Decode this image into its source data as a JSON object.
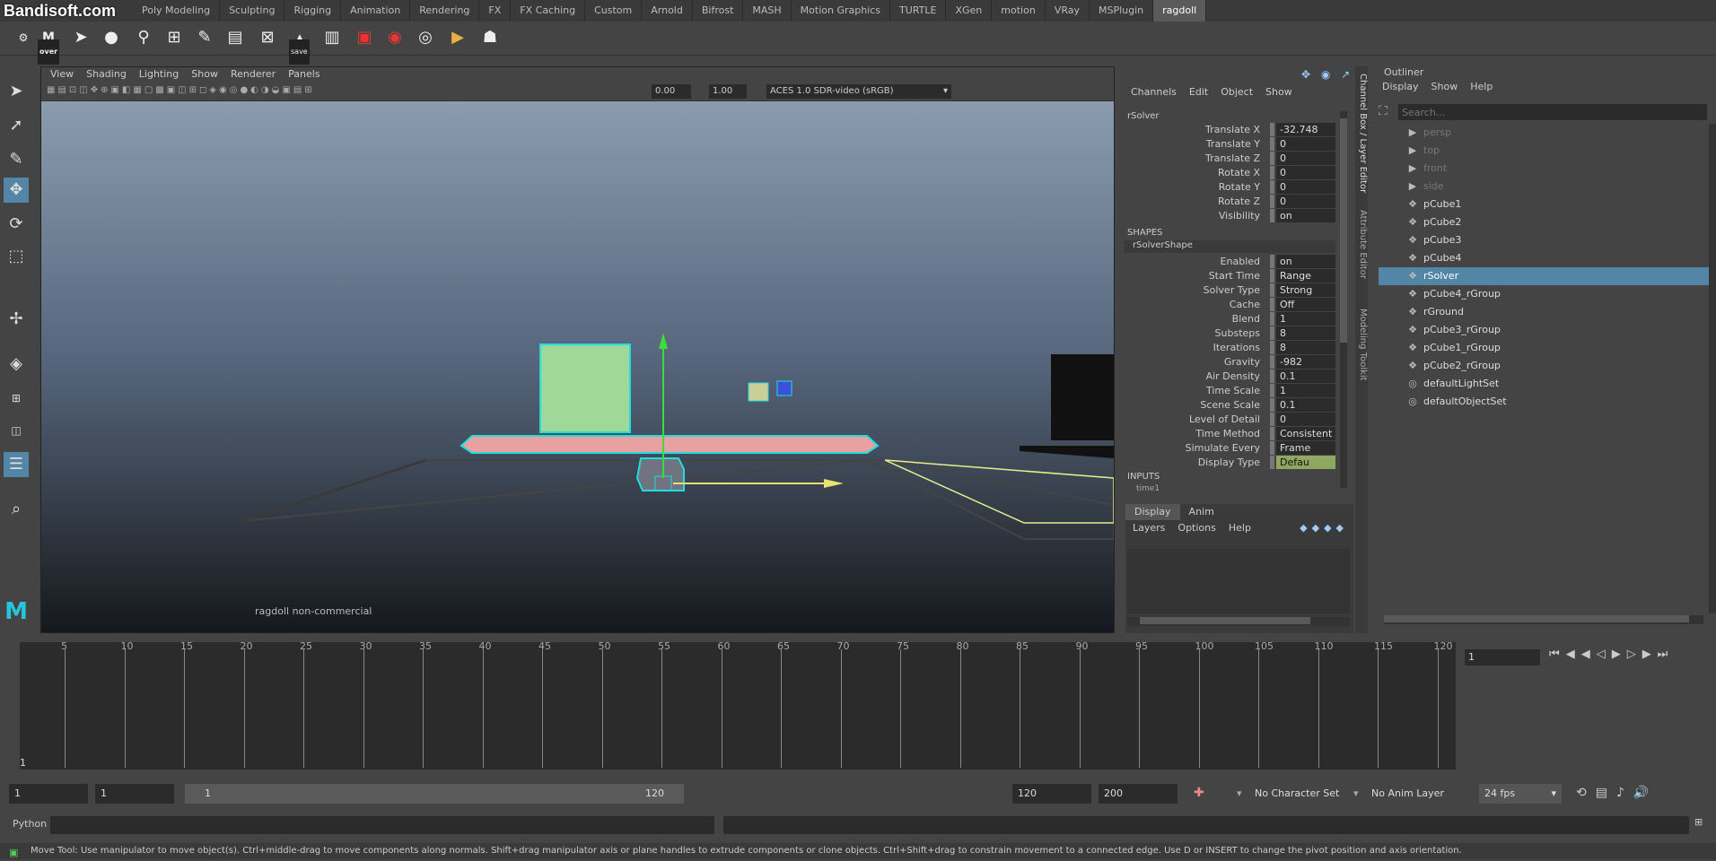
{
  "watermark": "Bandisoft.com",
  "shelf_tabs": [
    "Poly Modeling",
    "Sculpting",
    "Rigging",
    "Animation",
    "Rendering",
    "FX",
    "FX Caching",
    "Custom",
    "Arnold",
    "Bifrost",
    "MASH",
    "Motion Graphics",
    "TURTLE",
    "XGen",
    "motion",
    "VRay",
    "MSPlugin",
    "ragdoll"
  ],
  "active_tab": "ragdoll",
  "shelf": {
    "over_label": "over",
    "save_label": "save"
  },
  "viewport": {
    "menu": [
      "View",
      "Shading",
      "Lighting",
      "Show",
      "Renderer",
      "Panels"
    ],
    "exposure": "0.00",
    "gamma": "1.00",
    "colorspace": "ACES 1.0 SDR-video (sRGB)",
    "hud_text": "ragdoll non-commercial"
  },
  "channel_box": {
    "menu": [
      "Channels",
      "Edit",
      "Object",
      "Show"
    ],
    "node": "rSolver",
    "attrs": [
      {
        "label": "Translate X",
        "value": "-32.748"
      },
      {
        "label": "Translate Y",
        "value": "0"
      },
      {
        "label": "Translate Z",
        "value": "0"
      },
      {
        "label": "Rotate X",
        "value": "0"
      },
      {
        "label": "Rotate Y",
        "value": "0"
      },
      {
        "label": "Rotate Z",
        "value": "0"
      },
      {
        "label": "Visibility",
        "value": "on"
      }
    ],
    "shapes_header": "SHAPES",
    "shape_node": "rSolverShape",
    "shape_attrs": [
      {
        "label": "Enabled",
        "value": "on"
      },
      {
        "label": "Start Time",
        "value": "Range Start"
      },
      {
        "label": "Solver Type",
        "value": "Strong"
      },
      {
        "label": "Cache",
        "value": "Off"
      },
      {
        "label": "Blend",
        "value": "1"
      },
      {
        "label": "Substeps",
        "value": "8"
      },
      {
        "label": "Iterations",
        "value": "8"
      },
      {
        "label": "Gravity",
        "value": "-982"
      },
      {
        "label": "Air Density",
        "value": "0.1"
      },
      {
        "label": "Time Scale",
        "value": "1"
      },
      {
        "label": "Scene Scale",
        "value": "0.1"
      },
      {
        "label": "Level of Detail",
        "value": "0"
      },
      {
        "label": "Time Method",
        "value": "Consistent"
      },
      {
        "label": "Simulate Every",
        "value": "Frame"
      },
      {
        "label": "Display Type",
        "value": "Defau"
      }
    ],
    "inputs_header": "INPUTS",
    "input_node": "time1",
    "layer_tabs": [
      "Display",
      "Anim"
    ],
    "layer_menu": [
      "Layers",
      "Options",
      "Help"
    ]
  },
  "side_tabs": [
    "Channel Box / Layer Editor",
    "Attribute Editor",
    "Modeling Toolkit"
  ],
  "outliner": {
    "title": "Outliner",
    "menu": [
      "Display",
      "Show",
      "Help"
    ],
    "search_placeholder": "Search...",
    "items": [
      {
        "name": "persp",
        "dim": true
      },
      {
        "name": "top",
        "dim": true
      },
      {
        "name": "front",
        "dim": true
      },
      {
        "name": "side",
        "dim": true
      },
      {
        "name": "pCube1"
      },
      {
        "name": "pCube2"
      },
      {
        "name": "pCube3"
      },
      {
        "name": "pCube4"
      },
      {
        "name": "rSolver",
        "selected": true
      },
      {
        "name": "pCube4_rGroup"
      },
      {
        "name": "rGround"
      },
      {
        "name": "pCube3_rGroup"
      },
      {
        "name": "pCube1_rGroup"
      },
      {
        "name": "pCube2_rGroup"
      },
      {
        "name": "defaultLightSet"
      },
      {
        "name": "defaultObjectSet"
      }
    ]
  },
  "timeline": {
    "ticks": [
      "5",
      "10",
      "15",
      "20",
      "25",
      "30",
      "35",
      "40",
      "45",
      "50",
      "55",
      "60",
      "65",
      "70",
      "75",
      "80",
      "85",
      "90",
      "95",
      "100",
      "105",
      "110",
      "115",
      "120"
    ],
    "current_frame": "1",
    "frame_field": "1"
  },
  "range": {
    "start": "1",
    "anim_start": "1",
    "slider_start": "1",
    "slider_end": "120",
    "end": "120",
    "anim_end": "200",
    "character_set": "No Character Set",
    "anim_layer": "No Anim Layer",
    "fps": "24 fps"
  },
  "cmdline": {
    "lang": "Python"
  },
  "helpline": "Move Tool: Use manipulator to move object(s). Ctrl+middle-drag to move components along normals. Shift+drag manipulator axis or plane handles to extrude components or clone objects. Ctrl+Shift+drag to constrain movement to a connected edge. Use D or INSERT to change the pivot position and axis orientation."
}
